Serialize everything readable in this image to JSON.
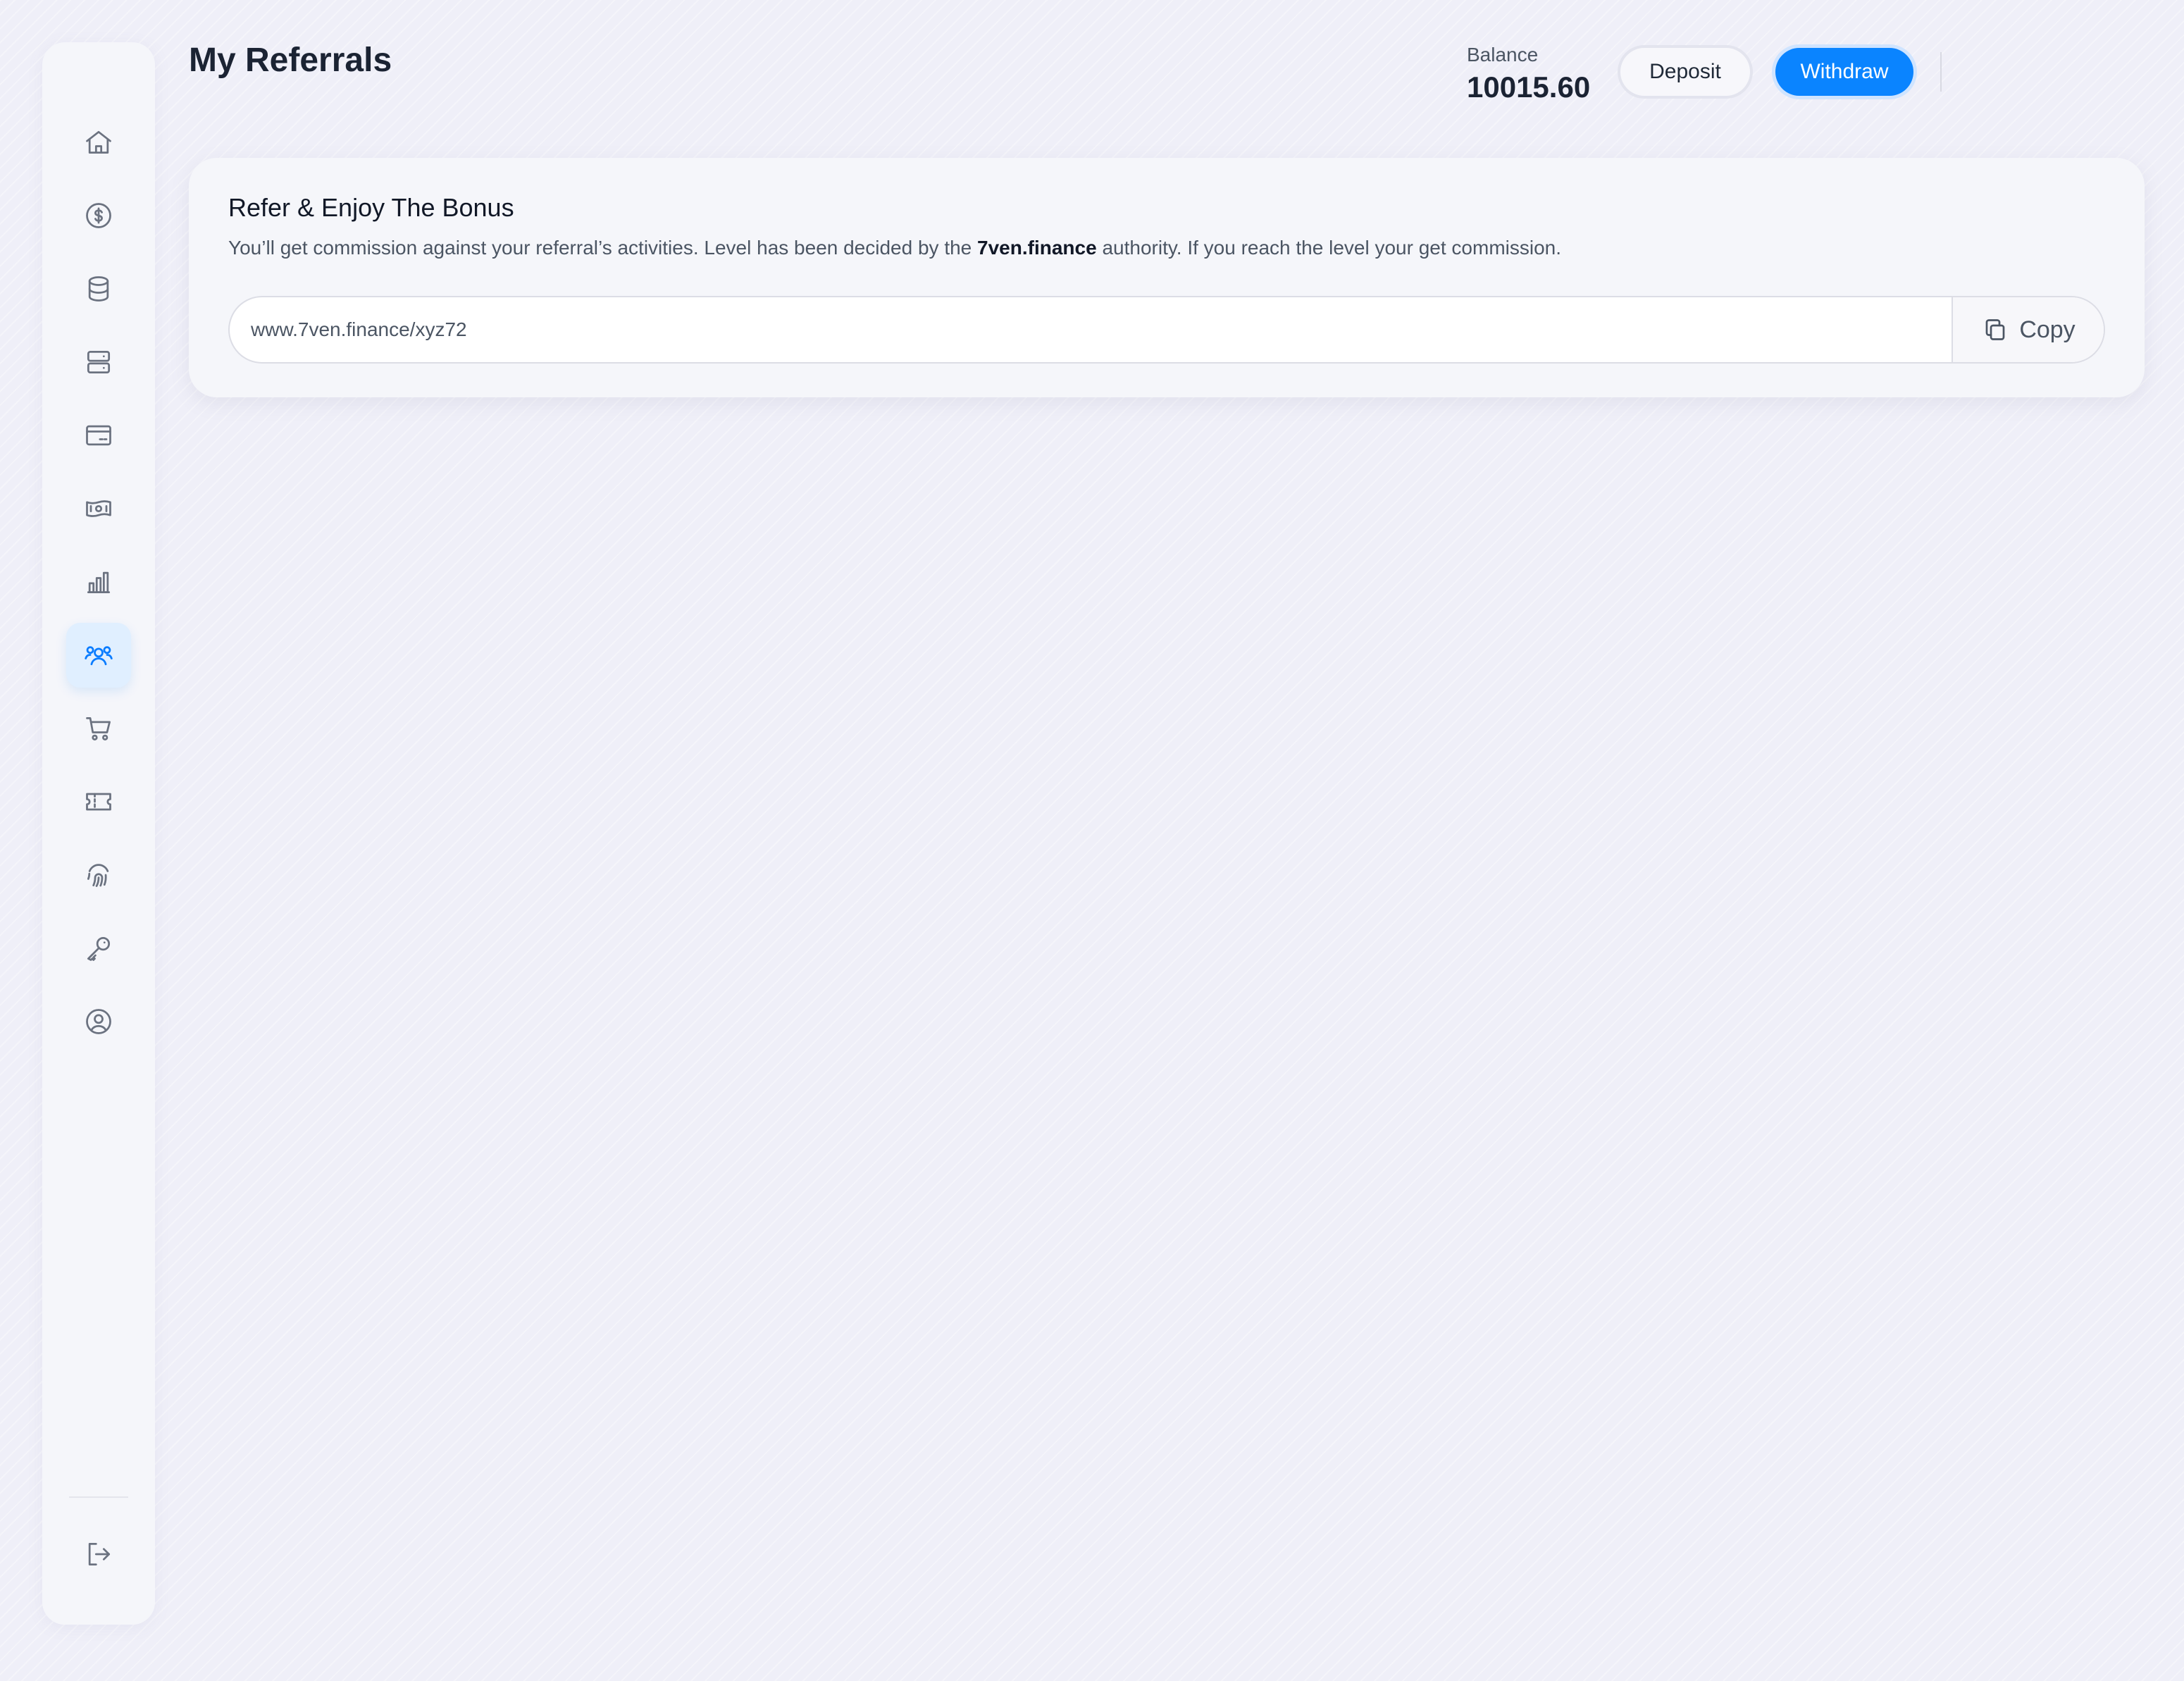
{
  "header": {
    "title": "My Referrals",
    "balance_label": "Balance",
    "balance_value": "10015.60",
    "deposit_label": "Deposit",
    "withdraw_label": "Withdraw"
  },
  "sidebar": {
    "items": [
      {
        "icon": "home-icon"
      },
      {
        "icon": "dollar-circle-icon"
      },
      {
        "icon": "database-icon"
      },
      {
        "icon": "server-icon"
      },
      {
        "icon": "credit-card-icon"
      },
      {
        "icon": "banknote-icon"
      },
      {
        "icon": "bar-chart-icon"
      },
      {
        "icon": "users-icon",
        "active": true
      },
      {
        "icon": "shopping-cart-icon"
      },
      {
        "icon": "ticket-icon"
      },
      {
        "icon": "fingerprint-icon"
      },
      {
        "icon": "key-icon"
      },
      {
        "icon": "user-circle-icon"
      }
    ],
    "logout_icon": "logout-icon"
  },
  "referral_card": {
    "title": "Refer & Enjoy The Bonus",
    "desc_before": "You’ll get commission against your referral’s activities. Level has been decided by the ",
    "desc_brand": "7ven.finance",
    "desc_after": " authority. If you reach the level your get commission.",
    "link_value": "www.7ven.finance/xyz72",
    "copy_label": "Copy"
  },
  "colors": {
    "accent": "#0a84ff",
    "active_nav_bg": "#e0efff",
    "background": "#efeff8"
  }
}
